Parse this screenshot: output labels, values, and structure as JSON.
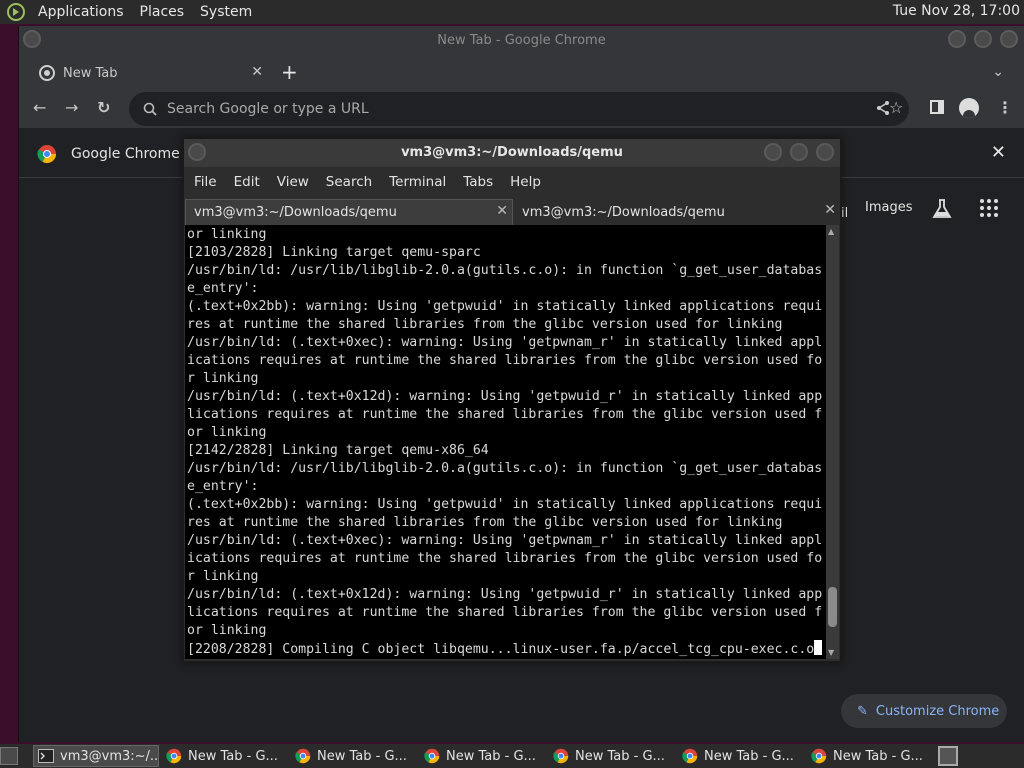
{
  "top_panel": {
    "menus": [
      "Applications",
      "Places",
      "System"
    ],
    "clock": "Tue Nov 28, 17:00"
  },
  "chrome": {
    "window_title": "New Tab - Google Chrome",
    "tab": {
      "label": "New Tab"
    },
    "omnibox_placeholder": "Search Google or type a URL",
    "infobar_text": "Google Chrome is",
    "ntp": {
      "gmail_label": "il",
      "images_label": "Images",
      "customize_label": "Customize Chrome"
    },
    "accent": "#8ab4f8"
  },
  "terminal": {
    "window_title": "vm3@vm3:~/Downloads/qemu",
    "menus": [
      "File",
      "Edit",
      "View",
      "Search",
      "Terminal",
      "Tabs",
      "Help"
    ],
    "tabs": [
      "vm3@vm3:~/Downloads/qemu",
      "vm3@vm3:~/Downloads/qemu"
    ],
    "lines": [
      "or linking",
      "[2103/2828] Linking target qemu-sparc",
      "/usr/bin/ld: /usr/lib/libglib-2.0.a(gutils.c.o): in function `g_get_user_databas",
      "e_entry':",
      "(.text+0x2bb): warning: Using 'getpwuid' in statically linked applications requi",
      "res at runtime the shared libraries from the glibc version used for linking",
      "/usr/bin/ld: (.text+0xec): warning: Using 'getpwnam_r' in statically linked appl",
      "ications requires at runtime the shared libraries from the glibc version used fo",
      "r linking",
      "/usr/bin/ld: (.text+0x12d): warning: Using 'getpwuid_r' in statically linked app",
      "lications requires at runtime the shared libraries from the glibc version used f",
      "or linking",
      "[2142/2828] Linking target qemu-x86_64",
      "/usr/bin/ld: /usr/lib/libglib-2.0.a(gutils.c.o): in function `g_get_user_databas",
      "e_entry':",
      "(.text+0x2bb): warning: Using 'getpwuid' in statically linked applications requi",
      "res at runtime the shared libraries from the glibc version used for linking",
      "/usr/bin/ld: (.text+0xec): warning: Using 'getpwnam_r' in statically linked appl",
      "ications requires at runtime the shared libraries from the glibc version used fo",
      "r linking",
      "/usr/bin/ld: (.text+0x12d): warning: Using 'getpwuid_r' in statically linked app",
      "lications requires at runtime the shared libraries from the glibc version used f",
      "or linking",
      "[2208/2828] Compiling C object libqemu...linux-user.fa.p/accel_tcg_cpu-exec.c.o"
    ],
    "scroll_position": 0.95
  },
  "taskbar": {
    "items": [
      {
        "label": "vm3@vm3:~/...",
        "icon": "terminal-icon",
        "active": true
      },
      {
        "label": "New Tab - G...",
        "icon": "chrome-icon",
        "active": false
      },
      {
        "label": "New Tab - G...",
        "icon": "chrome-icon",
        "active": false
      },
      {
        "label": "New Tab - G...",
        "icon": "chrome-icon",
        "active": false
      },
      {
        "label": "New Tab - G...",
        "icon": "chrome-icon",
        "active": false
      },
      {
        "label": "New Tab - G...",
        "icon": "chrome-icon",
        "active": false
      },
      {
        "label": "New Tab - G...",
        "icon": "chrome-icon",
        "active": false
      }
    ]
  }
}
